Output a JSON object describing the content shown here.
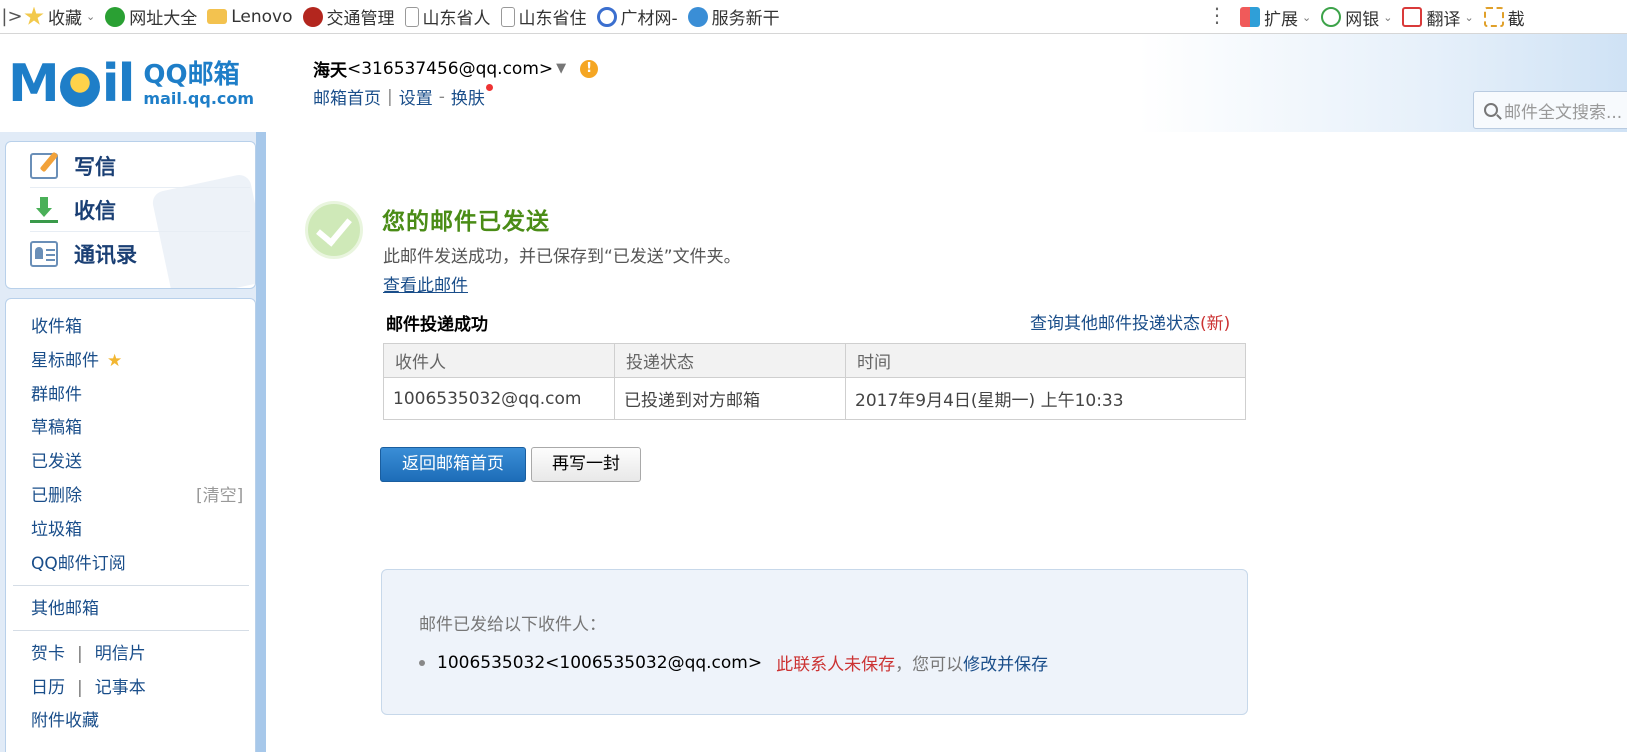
{
  "bookmarks": {
    "left": [
      {
        "label": "收藏",
        "icon": "star-icon",
        "color": "#f2b631",
        "dropdown": true
      },
      {
        "label": "网址大全",
        "icon": "navigation-icon",
        "color": "#2aa033"
      },
      {
        "label": "Lenovo",
        "icon": "folder-icon",
        "color": "#f3c24f"
      },
      {
        "label": "交通管理",
        "icon": "police-badge-icon",
        "color": "#b3261e"
      },
      {
        "label": "山东省人",
        "icon": "page-icon",
        "color": "#cccccc"
      },
      {
        "label": "山东省住",
        "icon": "page-icon",
        "color": "#cccccc"
      },
      {
        "label": "广材网-",
        "icon": "g-logo-icon",
        "color": "#3b6fcf"
      },
      {
        "label": "服务新干",
        "icon": "globe-icon",
        "color": "#3a8ed6"
      }
    ],
    "right": [
      {
        "label": "扩展",
        "icon": "extension-icon",
        "color": "#2f9fd8"
      },
      {
        "label": "网银",
        "icon": "bank-icon",
        "color": "#3da34a"
      },
      {
        "label": "翻译",
        "icon": "translate-icon",
        "color": "#d93a3a"
      },
      {
        "label": "截",
        "icon": "screenshot-icon",
        "color": "#e0a02a"
      }
    ]
  },
  "header": {
    "logo_text": "M il",
    "logo_qq": "QQ邮箱",
    "logo_url": "mail.qq.com",
    "user_name": "海天",
    "user_email": "<316537456@qq.com>",
    "links": {
      "home": "邮箱首页",
      "settings": "设置",
      "skin": "换肤"
    },
    "search_placeholder": "邮件全文搜索..."
  },
  "quick_actions": [
    {
      "label": "写信",
      "icon": "compose-icon"
    },
    {
      "label": "收信",
      "icon": "download-icon"
    },
    {
      "label": "通讯录",
      "icon": "contacts-icon"
    }
  ],
  "folders": {
    "inbox": "收件箱",
    "starred": "星标邮件",
    "group": "群邮件",
    "drafts": "草稿箱",
    "sent": "已发送",
    "deleted": "已删除",
    "clear": "[清空]",
    "spam": "垃圾箱",
    "subscriptions": "QQ邮件订阅",
    "other": "其他邮箱",
    "card": "贺卡",
    "postcard": "明信片",
    "calendar": "日历",
    "notes": "记事本",
    "attachments": "附件收藏"
  },
  "main": {
    "title": "您的邮件已发送",
    "description": "此邮件发送成功，并已保存到“已发送”文件夹。",
    "view_link": "查看此邮件",
    "delivery_title": "邮件投递成功",
    "query_link": "查询其他邮件投递状态",
    "query_new": "(新)",
    "table": {
      "headers": [
        "收件人",
        "投递状态",
        "时间"
      ],
      "rows": [
        [
          "1006535032@qq.com",
          "已投递到对方邮箱",
          "2017年9月4日(星期一) 上午10:33"
        ]
      ]
    },
    "btn_home": "返回邮箱首页",
    "btn_again": "再写一封",
    "recipients_title": "邮件已发给以下收件人：",
    "recipient": "1006535032<1006535032@qq.com>",
    "recipient_warning": "此联系人未保存",
    "recipient_hint": "，您可以",
    "recipient_action": "修改并保存"
  },
  "colors": {
    "accent": "#1a4e8a",
    "success": "#4a8c16",
    "primary_button": "#1d6db8",
    "warning": "#c33333"
  }
}
